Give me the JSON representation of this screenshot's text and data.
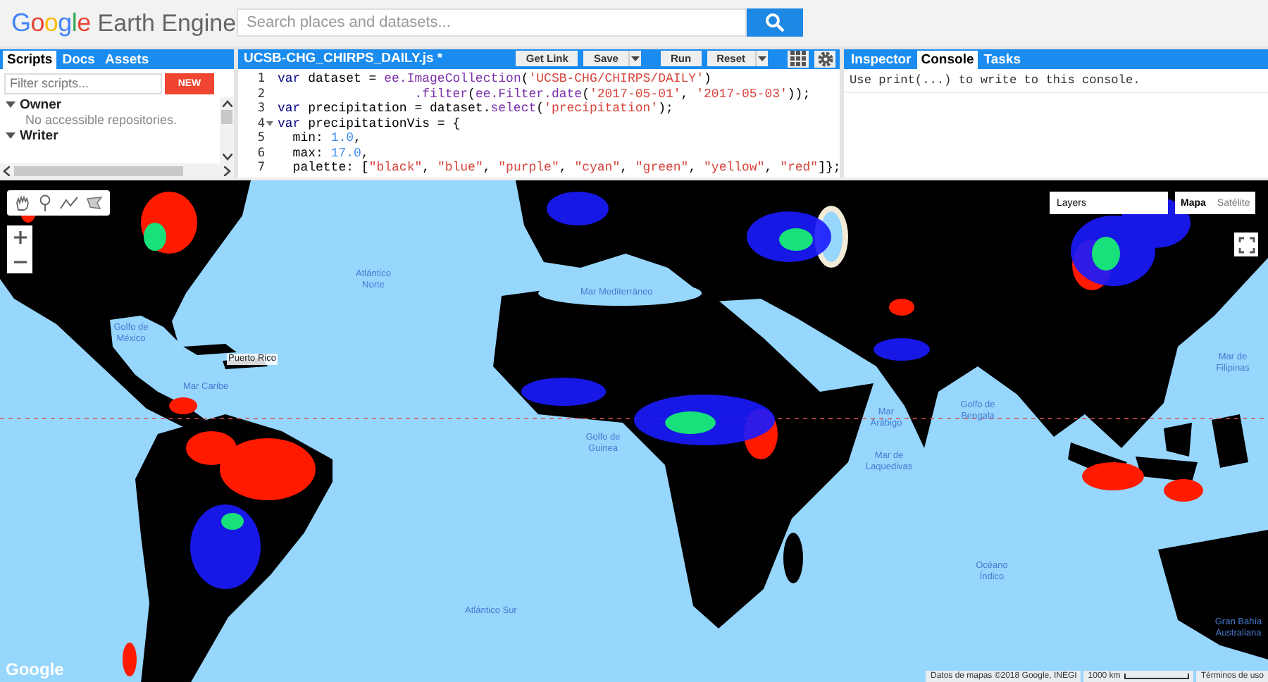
{
  "header": {
    "logo_google": "Google",
    "logo_product": "Earth Engine",
    "search": {
      "placeholder": "Search places and datasets..."
    }
  },
  "scripts_panel": {
    "tabs": [
      {
        "label": "Scripts",
        "selected": true
      },
      {
        "label": "Docs",
        "selected": false
      },
      {
        "label": "Assets",
        "selected": false
      }
    ],
    "filter": {
      "placeholder": "Filter scripts..."
    },
    "new_button": "NEW",
    "tree": [
      {
        "label": "Owner",
        "expanded": true,
        "children": [
          {
            "label": "No accessible repositories."
          }
        ]
      },
      {
        "label": "Writer",
        "expanded": true
      }
    ]
  },
  "editor": {
    "file_name": "UCSB-CHG_CHIRPS_DAILY.js *",
    "buttons": [
      {
        "label": "Get Link",
        "dropdown": false
      },
      {
        "label": "Save",
        "dropdown": true
      },
      {
        "label": "Run",
        "dropdown": false
      },
      {
        "label": "Reset",
        "dropdown": true
      }
    ],
    "lines": [
      {
        "number": "1",
        "fold": false,
        "tokens": [
          {
            "kind": "keyword",
            "text": "var"
          },
          {
            "kind": "plain",
            "text": " dataset = "
          },
          {
            "kind": "function",
            "text": "ee.ImageCollection"
          },
          {
            "kind": "plain",
            "text": "("
          },
          {
            "kind": "string",
            "text": "'UCSB-CHG/CHIRPS/DAILY'"
          },
          {
            "kind": "plain",
            "text": ")"
          }
        ]
      },
      {
        "number": "2",
        "fold": false,
        "tokens": [
          {
            "kind": "function",
            "text": "                  .filter"
          },
          {
            "kind": "plain",
            "text": "("
          },
          {
            "kind": "function",
            "text": "ee.Filter.date"
          },
          {
            "kind": "plain",
            "text": "("
          },
          {
            "kind": "string",
            "text": "'2017-05-01'"
          },
          {
            "kind": "plain",
            "text": ", "
          },
          {
            "kind": "string",
            "text": "'2017-05-03'"
          },
          {
            "kind": "plain",
            "text": "));"
          }
        ]
      },
      {
        "number": "3",
        "fold": false,
        "tokens": [
          {
            "kind": "keyword",
            "text": "var"
          },
          {
            "kind": "plain",
            "text": " precipitation = dataset."
          },
          {
            "kind": "function",
            "text": "select"
          },
          {
            "kind": "plain",
            "text": "("
          },
          {
            "kind": "string",
            "text": "'precipitation'"
          },
          {
            "kind": "plain",
            "text": ");"
          }
        ]
      },
      {
        "number": "4",
        "fold": true,
        "tokens": [
          {
            "kind": "keyword",
            "text": "var"
          },
          {
            "kind": "plain",
            "text": " precipitationVis = {"
          }
        ]
      },
      {
        "number": "5",
        "fold": false,
        "tokens": [
          {
            "kind": "plain",
            "text": "  min: "
          },
          {
            "kind": "number",
            "text": "1.0"
          },
          {
            "kind": "plain",
            "text": ","
          }
        ]
      },
      {
        "number": "6",
        "fold": false,
        "tokens": [
          {
            "kind": "plain",
            "text": "  max: "
          },
          {
            "kind": "number",
            "text": "17.0"
          },
          {
            "kind": "plain",
            "text": ","
          }
        ]
      },
      {
        "number": "7",
        "fold": false,
        "tokens": [
          {
            "kind": "plain",
            "text": "  palette: ["
          },
          {
            "kind": "string",
            "text": "\"black\""
          },
          {
            "kind": "plain",
            "text": ", "
          },
          {
            "kind": "string",
            "text": "\"blue\""
          },
          {
            "kind": "plain",
            "text": ", "
          },
          {
            "kind": "string",
            "text": "\"purple\""
          },
          {
            "kind": "plain",
            "text": ", "
          },
          {
            "kind": "string",
            "text": "\"cyan\""
          },
          {
            "kind": "plain",
            "text": ", "
          },
          {
            "kind": "string",
            "text": "\"green\""
          },
          {
            "kind": "plain",
            "text": ", "
          },
          {
            "kind": "string",
            "text": "\"yellow\""
          },
          {
            "kind": "plain",
            "text": ", "
          },
          {
            "kind": "string",
            "text": "\"red\""
          },
          {
            "kind": "plain",
            "text": "]};"
          }
        ]
      }
    ]
  },
  "console_panel": {
    "tabs": [
      {
        "label": "Inspector",
        "selected": false
      },
      {
        "label": "Console",
        "selected": true
      },
      {
        "label": "Tasks",
        "selected": false
      }
    ],
    "message": "Use print(...) to write to this console."
  },
  "map": {
    "layers_label": "Layers",
    "map_types": [
      {
        "label": "Mapa",
        "selected": true
      },
      {
        "label": "Satélite",
        "selected": false
      }
    ],
    "labels": [
      {
        "kind": "ocean",
        "text": "Atlántico Norte"
      },
      {
        "kind": "ocean",
        "text": "Golfo de México"
      },
      {
        "kind": "ocean",
        "text": "Mar Caribe"
      },
      {
        "kind": "place",
        "text": "Puerto Rico"
      },
      {
        "kind": "ocean",
        "text": "Mar Mediterráneo"
      },
      {
        "kind": "ocean",
        "text": "Mar Arábigo"
      },
      {
        "kind": "ocean",
        "text": "Golfo de Bengala"
      },
      {
        "kind": "ocean",
        "text": "Mar de Laquedivas"
      },
      {
        "kind": "ocean",
        "text": "Mar de Filipinas"
      },
      {
        "kind": "ocean",
        "text": "Golfo de Guinea"
      },
      {
        "kind": "ocean",
        "text": "Atlántico Sur"
      },
      {
        "kind": "ocean",
        "text": "Océano Índico"
      },
      {
        "kind": "ocean",
        "text": "Gran Bahía Australiana"
      }
    ],
    "attribution": "Datos de mapas ©2018 Google, INEGI",
    "scale": "1000 km",
    "terms": "Términos de uso",
    "logo": "Google"
  }
}
